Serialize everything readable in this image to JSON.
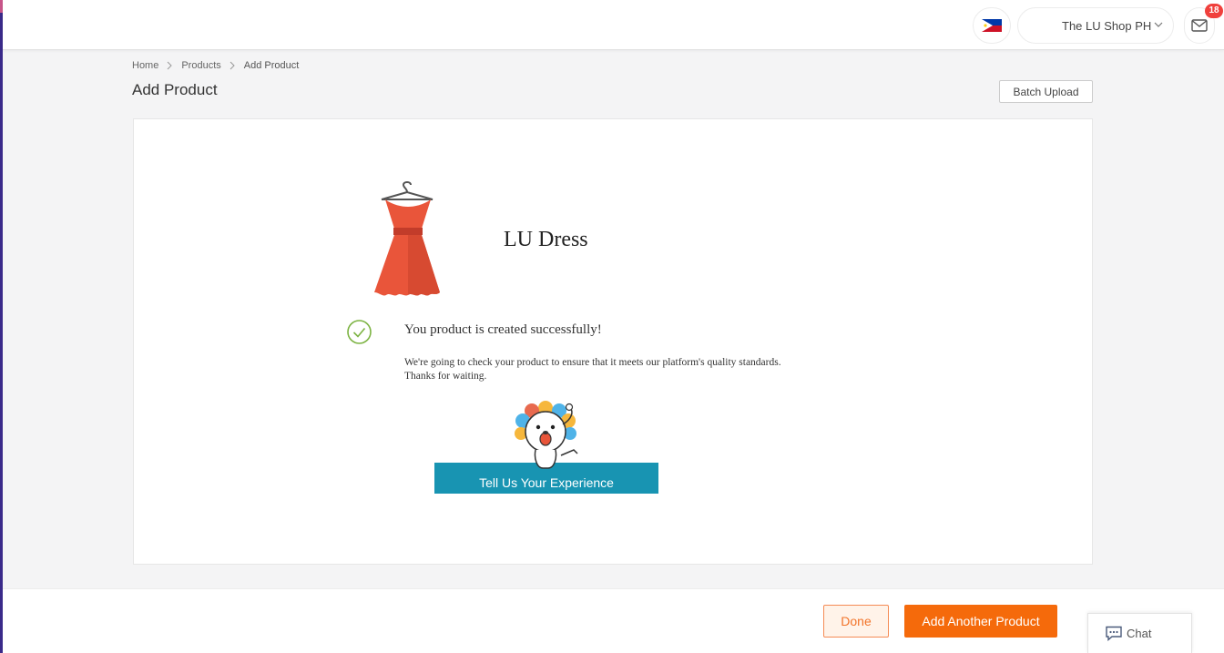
{
  "header": {
    "country_flag": "philippines-flag-icon",
    "shop_name": "The LU Shop PH",
    "notification_count": "18"
  },
  "breadcrumb": {
    "items": [
      "Home",
      "Products",
      "Add Product"
    ]
  },
  "page": {
    "title": "Add Product",
    "batch_upload_label": "Batch Upload"
  },
  "result": {
    "product_name": "LU Dress",
    "success_title": "You product is created successfully!",
    "success_note": "We're going to check your product to ensure that it meets our platform's quality standards. Thanks for waiting.",
    "feedback_button": "Tell Us Your Experience"
  },
  "footer": {
    "done_label": "Done",
    "add_another_label": "Add Another Product",
    "chat_label": "Chat"
  },
  "colors": {
    "primary_orange": "#f56a0b",
    "success_green": "#7cb342",
    "feedback_teal": "#1894b2",
    "dress_red": "#e9553a"
  }
}
